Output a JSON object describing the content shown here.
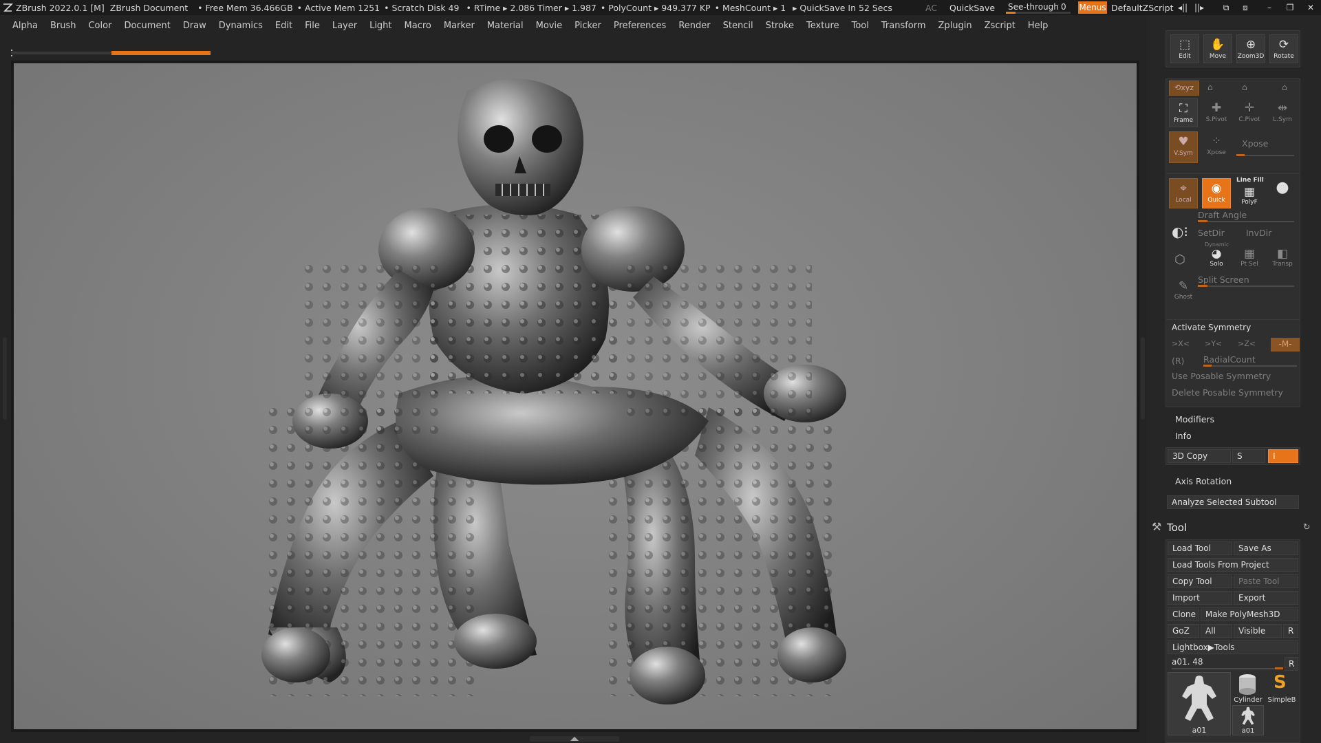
{
  "titlebar": {
    "app": "ZBrush 2022.0.1 [M]",
    "document": "ZBrush Document",
    "free_mem": "• Free Mem 36.466GB",
    "active_mem": "• Active Mem 1251",
    "scratch": "• Scratch Disk 49",
    "rtime": "• RTime ▸ 2.086 Timer ▸ 1.987",
    "polycount": "• PolyCount ▸ 949.377 KP",
    "meshcount": "• MeshCount ▸ 1",
    "quicksave_timer": "▸ QuickSave In 52 Secs",
    "ac": "AC",
    "quicksave": "QuickSave",
    "see_through_label": "See-through",
    "see_through_value": "0",
    "see_through_level": 0.15,
    "menus": "Menus",
    "script": "DefaultZScript"
  },
  "menu": [
    "Alpha",
    "Brush",
    "Color",
    "Document",
    "Draw",
    "Dynamics",
    "Edit",
    "File",
    "Layer",
    "Light",
    "Macro",
    "Marker",
    "Material",
    "Movie",
    "Picker",
    "Preferences",
    "Render",
    "Stencil",
    "Stroke",
    "Texture",
    "Tool",
    "Transform",
    "Zplugin",
    "Zscript",
    "Help"
  ],
  "nav_buttons": [
    "Edit",
    "Move",
    "Zoom3D",
    "Rotate"
  ],
  "xyz": {
    "buttons": [
      "Frame",
      "S.Pivot",
      "C.Pivot",
      "L.Sym"
    ],
    "vsym": "V.Sym",
    "xpose_btn": "Xpose",
    "xpose": "Xpose"
  },
  "draw_panel": {
    "local": "Local",
    "quick": "Quick",
    "line_fill": "Line Fill",
    "polyf": "PolyF",
    "draft_angle": "Draft Angle",
    "setdir": "SetDir",
    "invdir": "InvDir",
    "dynamic": "Dynamic",
    "solo": "Solo",
    "ptsel": "Pt Sel",
    "transp": "Transp",
    "ghost": "Ghost",
    "split_screen": "Split Screen"
  },
  "symmetry": {
    "activate": "Activate Symmetry",
    "axes": [
      ">X<",
      ">Y<",
      ">Z<"
    ],
    "m": "-M-",
    "r": "(R)",
    "radial": "RadialCount",
    "use_posable": "Use Posable Symmetry",
    "delete_posable": "Delete Posable Symmetry"
  },
  "sections": {
    "modifiers": "Modifiers",
    "info": "Info",
    "copy3d": "3D Copy",
    "s": "S",
    "i": "I",
    "axis_rotation": "Axis Rotation",
    "analyze": "Analyze Selected Subtool"
  },
  "tool": {
    "title": "Tool",
    "load_tool": "Load Tool",
    "save_as": "Save As",
    "load_from_project": "Load Tools From Project",
    "copy_tool": "Copy Tool",
    "paste_tool": "Paste Tool",
    "import": "Import",
    "export": "Export",
    "clone": "Clone",
    "make_polymesh": "Make PolyMesh3D",
    "goz": "GoZ",
    "all": "All",
    "visible": "Visible",
    "r": "R",
    "lightbox": "Lightbox▶Tools",
    "current": "a01. 48",
    "thumbs": [
      "a01",
      "Cylinder",
      "SimpleB",
      "a01"
    ]
  }
}
